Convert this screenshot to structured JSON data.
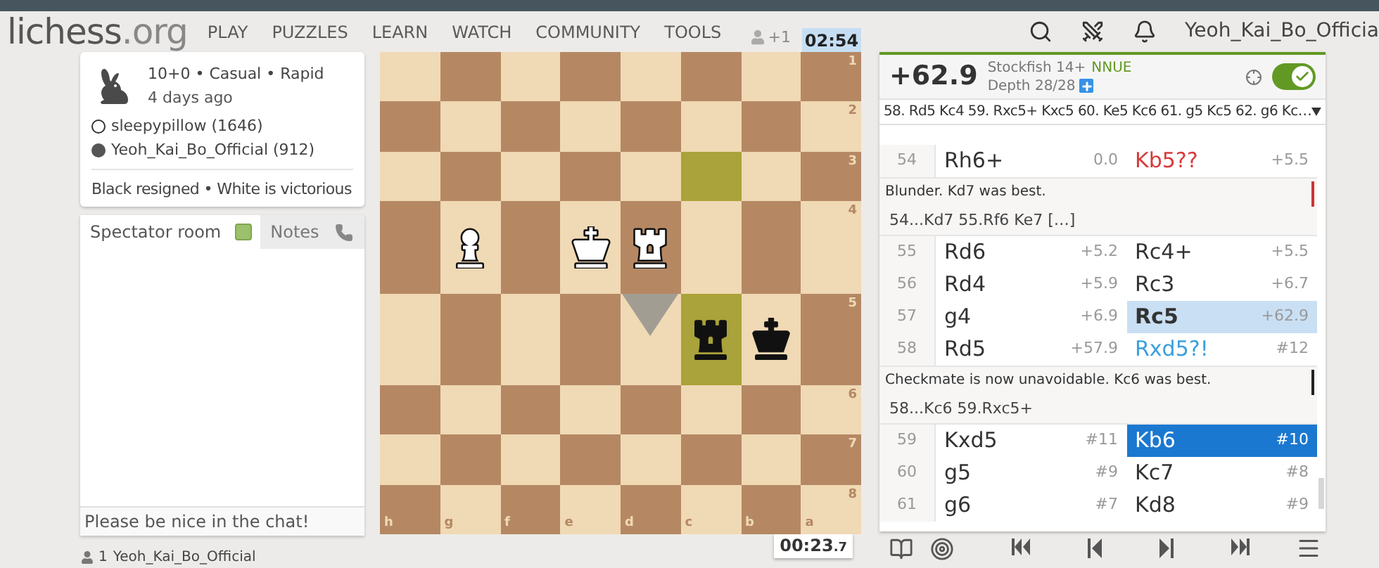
{
  "nav": {
    "logo": {
      "name": "lichess",
      "suffix": ".org"
    },
    "links": [
      "PLAY",
      "PUZZLES",
      "LEARN",
      "WATCH",
      "COMMUNITY",
      "TOOLS"
    ],
    "user": "Yeoh_Kai_Bo_Officia"
  },
  "game": {
    "title": "10+0 • Casual • Rapid",
    "when": "4 days ago",
    "result": "Black resigned • White is victorious",
    "players": [
      {
        "black": false,
        "name": "sleepypillow (1646)"
      },
      {
        "black": true,
        "name": "Yeoh_Kai_Bo_Official (912)"
      }
    ]
  },
  "chat": {
    "tabs": [
      {
        "label": "Spectator room",
        "selected": true,
        "checked": true
      },
      {
        "label": "Notes",
        "selected": false
      }
    ],
    "placeholder": "Please be nice in the chat!"
  },
  "spectators": {
    "count": "1",
    "names": "Yeoh_Kai_Bo_Official"
  },
  "board": {
    "top_clock": {
      "watchers": "+1",
      "time": "02:54",
      "active": true
    },
    "bottom_clock": {
      "time": "00:23",
      "fraction": ".7",
      "active": false
    },
    "files": [
      "h",
      "g",
      "f",
      "e",
      "d",
      "c",
      "b",
      "a"
    ],
    "ranks": [
      "1",
      "2",
      "3",
      "4",
      "5",
      "6",
      "7",
      "8"
    ],
    "rows": [
      [
        {},
        {},
        {},
        {},
        {},
        {},
        {},
        {}
      ],
      [
        {},
        {},
        {},
        {},
        {},
        {},
        {},
        {}
      ],
      [
        {},
        {},
        {},
        {},
        {},
        {
          "highlight": true
        },
        {},
        {}
      ],
      [
        {},
        {
          "kind": "pawn",
          "black": false
        },
        {},
        {
          "kind": "king",
          "black": false
        },
        {
          "kind": "rook",
          "black": false
        },
        {},
        {},
        {}
      ],
      [
        {},
        {},
        {},
        {},
        {
          "marker": true
        },
        {
          "kind": "rook",
          "black": true,
          "highlight": true
        },
        {
          "kind": "king",
          "black": true
        },
        {}
      ],
      [
        {},
        {},
        {},
        {},
        {},
        {},
        {},
        {}
      ],
      [
        {},
        {},
        {},
        {},
        {},
        {},
        {},
        {}
      ],
      [
        {},
        {},
        {},
        {},
        {},
        {},
        {},
        {}
      ]
    ]
  },
  "engine": {
    "eval": "+62.9",
    "name": "Stockfish 14+",
    "tag": "NNUE",
    "depth": "Depth 28/28",
    "on": true,
    "pv": "58. Rd5 Kc4 59. Rxc5+ Kxc5 60. Ke5 Kc6 61. g5 Kc5 62. g6 Kc…"
  },
  "moves": [
    {
      "kind": "row",
      "number": "54",
      "white": {
        "san": "Rh6+",
        "eval": "0.0",
        "selected": false,
        "current": false
      },
      "black": {
        "san": "Kb5??",
        "eval": "+5.5",
        "selected": false,
        "current": false,
        "color": "#d83a3a"
      }
    },
    {
      "kind": "comment",
      "text": "Blunder. Kd7 was best.",
      "line": "54...Kd7 55.Rf6 Ke7 […]",
      "color": "#cc3333"
    },
    {
      "kind": "row",
      "number": "55",
      "white": {
        "san": "Rd6",
        "eval": "+5.2",
        "selected": false,
        "current": false
      },
      "black": {
        "san": "Rc4+",
        "eval": "+5.5",
        "selected": false,
        "current": false
      }
    },
    {
      "kind": "row",
      "number": "56",
      "white": {
        "san": "Rd4",
        "eval": "+5.9",
        "selected": false,
        "current": false
      },
      "black": {
        "san": "Rc3",
        "eval": "+6.7",
        "selected": false,
        "current": false
      }
    },
    {
      "kind": "row",
      "number": "57",
      "white": {
        "san": "g4",
        "eval": "+6.9",
        "selected": false,
        "current": false
      },
      "black": {
        "san": "Rc5",
        "eval": "+62.9",
        "selected": false,
        "current": true
      }
    },
    {
      "kind": "row",
      "number": "58",
      "white": {
        "san": "Rd5",
        "eval": "+57.9",
        "selected": false,
        "current": false
      },
      "black": {
        "san": "Rxd5?!",
        "eval": "#12",
        "selected": false,
        "current": false,
        "color": "#3aa0dc"
      }
    },
    {
      "kind": "comment",
      "text": "Checkmate is now unavoidable. Kc6 was best.",
      "line": "58...Kc6 59.Rxc5+",
      "color": "#222222"
    },
    {
      "kind": "row",
      "number": "59",
      "white": {
        "san": "Kxd5",
        "eval": "#11",
        "selected": false,
        "current": false
      },
      "black": {
        "san": "Kb6",
        "eval": "#10",
        "selected": true,
        "current": false
      }
    },
    {
      "kind": "row",
      "number": "60",
      "white": {
        "san": "g5",
        "eval": "#9",
        "selected": false,
        "current": false
      },
      "black": {
        "san": "Kc7",
        "eval": "#8",
        "selected": false,
        "current": false
      }
    },
    {
      "kind": "row",
      "number": "61",
      "white": {
        "san": "g6",
        "eval": "#7",
        "selected": false,
        "current": false
      },
      "black": {
        "san": "Kd8",
        "eval": "#9",
        "selected": false,
        "current": false
      }
    }
  ]
}
